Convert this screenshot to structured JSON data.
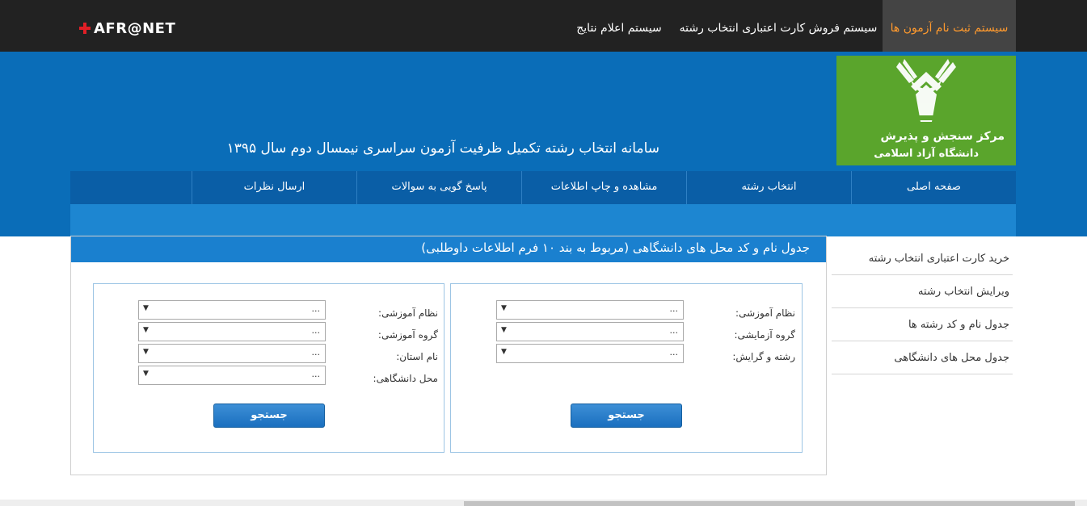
{
  "topbar": {
    "brand": "AFR@NET",
    "nav": [
      "سیستم ثبت نام آزمون ها",
      "سیستم فروش کارت اعتباری انتخاب رشته",
      "سیستم اعلام نتایج"
    ],
    "active_color": "#ff9a2e"
  },
  "header": {
    "logo_line1": "مرکز سنجش و پذیرش",
    "logo_line2": "دانشگاه آزاد اسلامی",
    "title": "سامانه انتخاب رشته تکمیل ظرفیت آزمون سراسری نیمسال دوم سال ۱۳۹۵"
  },
  "mainnav": [
    "صفحه اصلی",
    "انتخاب رشته",
    "مشاهده و چاپ اطلاعات",
    "پاسخ گویی به سوالات",
    "ارسال نظرات"
  ],
  "sidebar": [
    "خرید کارت اعتباری انتخاب رشته",
    "ویرایش انتخاب رشته",
    "جدول نام و کد رشته ها",
    "جدول محل های دانشگاهی"
  ],
  "content": {
    "title": "جدول نام و کد محل های دانشگاهی (مربوط به بند ۱۰ فرم اطلاعات داوطلبی)",
    "panel_right": {
      "fields": [
        {
          "label": "نظام آموزشی:",
          "value": "..."
        },
        {
          "label": "گروه آزمایشی:",
          "value": "..."
        },
        {
          "label": "رشته و گرایش:",
          "value": "..."
        }
      ],
      "button": "جستجو"
    },
    "panel_left": {
      "fields": [
        {
          "label": "نظام آموزشی:",
          "value": "..."
        },
        {
          "label": "گروه آموزشی:",
          "value": "..."
        },
        {
          "label": "نام استان:",
          "value": "..."
        },
        {
          "label": "محل دانشگاهی:",
          "value": "..."
        }
      ],
      "button": "جستجو"
    }
  },
  "colors": {
    "topbar": "#222222",
    "header_blue": "#0a6db8",
    "nav_blue": "#0a5ea6",
    "logo_green": "#5aa52c"
  }
}
